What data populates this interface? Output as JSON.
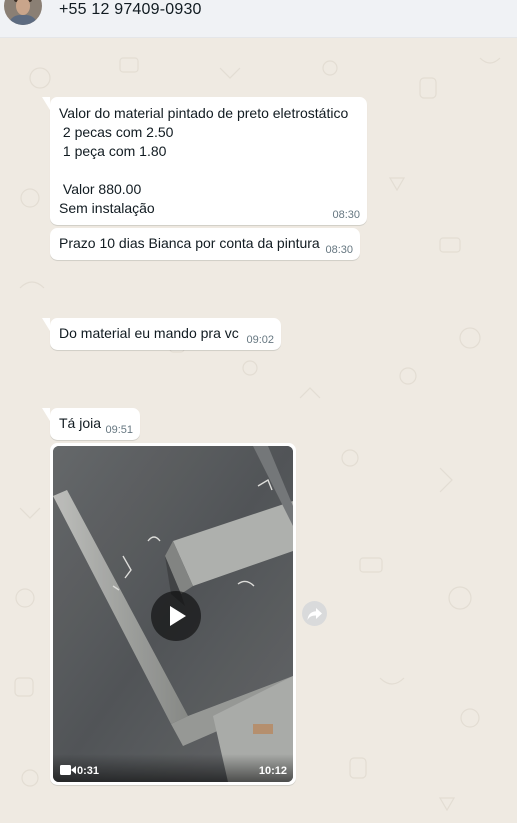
{
  "header": {
    "contact_name": "+55 12 97409-0930"
  },
  "messages": [
    {
      "text": "Valor do material pintado de preto eletrostático\n 2 pecas com 2.50\n 1 peça com 1.80\n\n Valor 880.00\nSem instalação",
      "time": "08:30"
    },
    {
      "text": "Prazo 10 dias Bianca por conta da pintura",
      "time": "08:30"
    },
    {
      "text": "Do material eu mando pra vc",
      "time": "09:02"
    },
    {
      "text": "Tá joia",
      "time": "09:51"
    }
  ],
  "video": {
    "duration": "0:31",
    "time": "10:12"
  },
  "icons": {
    "play": "play-icon",
    "video_camera": "video-camera-icon",
    "forward": "forward-icon"
  },
  "colors": {
    "chat_background": "#efeae2",
    "bubble": "#ffffff",
    "header": "#f0f2f5",
    "timestamp": "#667781"
  }
}
